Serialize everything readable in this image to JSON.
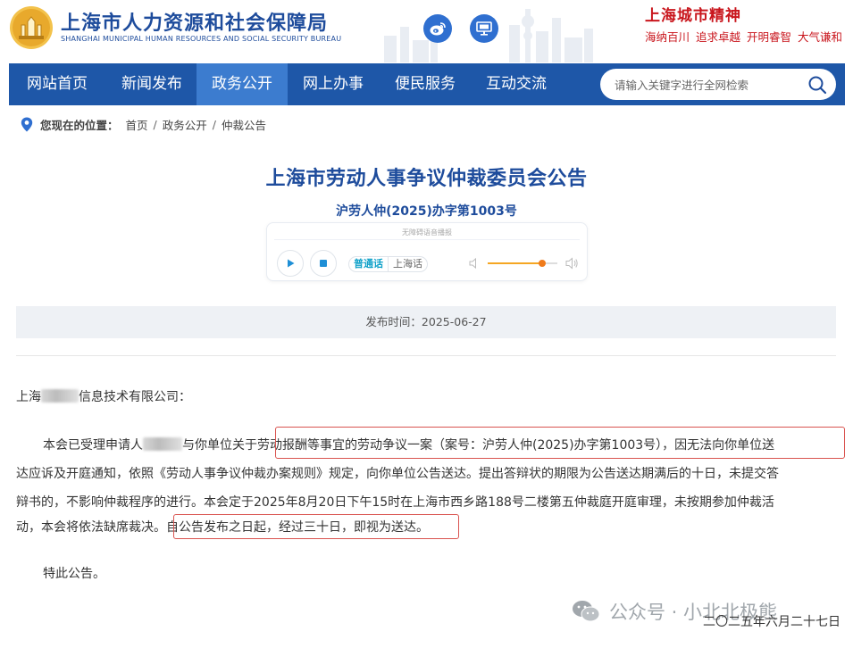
{
  "header": {
    "site_name": "上海市人力资源和社会保障局",
    "site_name_en": "SHANGHAI MUNICIPAL HUMAN RESOURCES AND SOCIAL SECURITY BUREAU",
    "city_spirit_title": "上海城市精神",
    "slogans": [
      "海纳百川",
      "追求卓越",
      "开明睿智",
      "大气谦和"
    ],
    "brand_color": "#1e4c9c",
    "accent_red": "#c9161d"
  },
  "nav": {
    "items": [
      {
        "label": "网站首页"
      },
      {
        "label": "新闻发布"
      },
      {
        "label": "政务公开"
      },
      {
        "label": "网上办事"
      },
      {
        "label": "便民服务"
      },
      {
        "label": "互动交流"
      }
    ],
    "active_index": 2,
    "search_placeholder": "请输入关键字进行全网检索",
    "nav_color": "#1e57a8",
    "active_color": "#3c7ccf"
  },
  "breadcrumb": {
    "prefix": "您现在的位置：",
    "items": [
      "首页",
      "政务公开",
      "仲裁公告"
    ],
    "separator": "/"
  },
  "document": {
    "title": "上海市劳动人事争议仲裁委员会公告",
    "doc_number": "沪劳人仲(2025)办字第1003号",
    "publish_label": "发布时间：",
    "publish_date": "2025-06-27",
    "addressee_pre": "上海",
    "addressee_post": "信息技术有限公司：",
    "p1_l1_a": "本会已受理申请人",
    "p1_l1_b": "与你单位关于",
    "p1_l1_c": "劳动报酬等事宜的劳动争议一案（案号：沪劳人仲(2025)办字第1003号），因无法向你单位送",
    "p1_l2": "达应诉及开庭通知，依照《劳动人事争议仲裁办案规则》规定，向你单位公告送达。提出答辩状的期限为公告送达期满后的十日，未提交答",
    "p1_l3": "辩书的，不影响仲裁程序的进行。本会定于2025年8月20日下午15时在上海市西乡路188号二楼第五仲裁庭开庭审理，未按期参加仲裁活",
    "p1_l4_a": "动，本会将依法缺席裁决。",
    "p1_l4_b": "自公告发布之日起，经过三十日，即视为送达。",
    "closing": "特此公告。",
    "sign_date": "二〇二五年六月二十七日"
  },
  "player": {
    "caption": "无障碍语音播报",
    "lang_options": [
      "普通话",
      "上海话"
    ],
    "selected_lang": "普通话",
    "volume": 0.78,
    "play_icon": "play-icon",
    "stop_icon": "stop-icon"
  },
  "watermark": {
    "text": "公众号 · 小北北极熊"
  }
}
